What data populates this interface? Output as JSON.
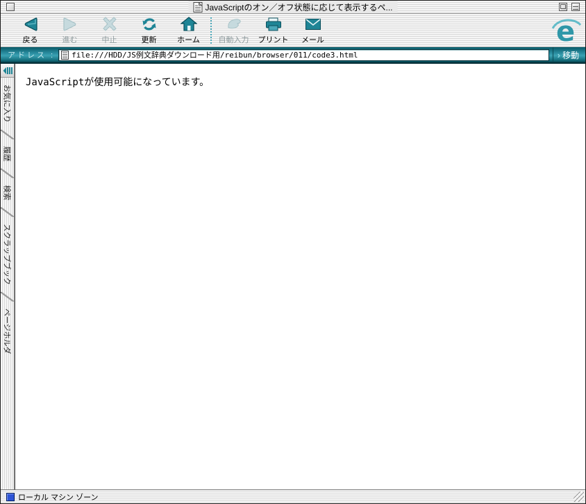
{
  "window": {
    "title": "JavaScriptのオン／オフ状態に応じて表示するペ..."
  },
  "toolbar": {
    "buttons": [
      {
        "label": "戻る",
        "icon": "back-icon",
        "enabled": true
      },
      {
        "label": "進む",
        "icon": "forward-icon",
        "enabled": false
      },
      {
        "label": "中止",
        "icon": "stop-icon",
        "enabled": false
      },
      {
        "label": "更新",
        "icon": "refresh-icon",
        "enabled": true
      },
      {
        "label": "ホーム",
        "icon": "home-icon",
        "enabled": true
      },
      {
        "label": "自動入力",
        "icon": "autofill-icon",
        "enabled": false
      },
      {
        "label": "プリント",
        "icon": "print-icon",
        "enabled": true
      },
      {
        "label": "メール",
        "icon": "mail-icon",
        "enabled": true
      }
    ],
    "logo": "internet-explorer-logo"
  },
  "address_bar": {
    "label": "アドレス :",
    "url": "file:///HDD/JS例文辞典ダウンロード用/reibun/browser/011/code3.html",
    "go_chevron": "›",
    "go_label": "移動"
  },
  "sidebar": {
    "tabs": [
      {
        "label": "お気に入り"
      },
      {
        "label": "履歴"
      },
      {
        "label": "検索"
      },
      {
        "label": "スクラップブック"
      },
      {
        "label": "ページホルダ"
      }
    ]
  },
  "content": {
    "message": "JavaScriptが使用可能になっています。"
  },
  "status_bar": {
    "zone_label": "ローカル マシン ゾーン"
  },
  "colors": {
    "accent_teal": "#1f8596",
    "address_bar_teal": "#2a8da0",
    "disabled_icon": "#c2d8dc"
  }
}
